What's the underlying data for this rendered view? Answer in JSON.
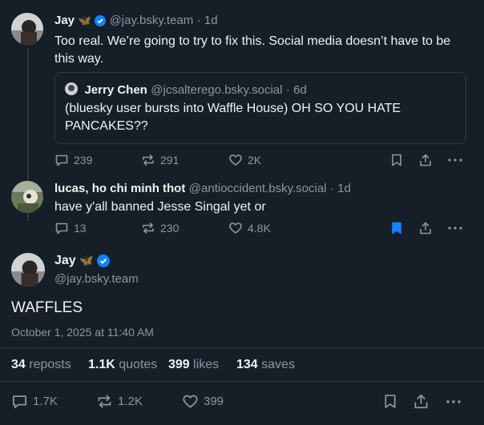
{
  "post1": {
    "author_name": "Jay",
    "author_emoji": "🦋",
    "handle": "@jay.bsky.team",
    "time": "· 1d",
    "text": "Too real. We’re going to try to fix this. Social media doesn’t have to be this way.",
    "quote": {
      "author_name": "Jerry Chen",
      "handle": "@jcsalterego.bsky.social",
      "time": "· 6d",
      "text": "(bluesky user bursts into Waffle House) OH SO YOU HATE PANCAKES??"
    },
    "replies": "239",
    "reposts": "291",
    "likes": "2K"
  },
  "post2": {
    "author_name": "lucas, ho chi minh thot",
    "handle": "@antioccident.bsky.social",
    "time": "· 1d",
    "text": "have y'all banned Jesse Singal yet or",
    "replies": "13",
    "reposts": "230",
    "likes": "4.8K"
  },
  "main": {
    "author_name": "Jay",
    "author_emoji": "🦋",
    "handle": "@jay.bsky.team",
    "text": "WAFFLES",
    "timestamp": "October 1, 2025 at 11:40 AM",
    "stats": {
      "reposts_num": "34",
      "reposts_label": "reposts",
      "quotes_num": "1.1K",
      "quotes_label": "quotes",
      "likes_num": "399",
      "likes_label": "likes",
      "saves_num": "134",
      "saves_label": "saves"
    },
    "replies": "1.7K",
    "reposts": "1.2K",
    "likes": "399"
  },
  "colors": {
    "background": "#161e27",
    "text": "#f1f3f5",
    "muted": "#8b98a5",
    "verified": "#1083fe",
    "bookmark_active": "#1083fe"
  }
}
